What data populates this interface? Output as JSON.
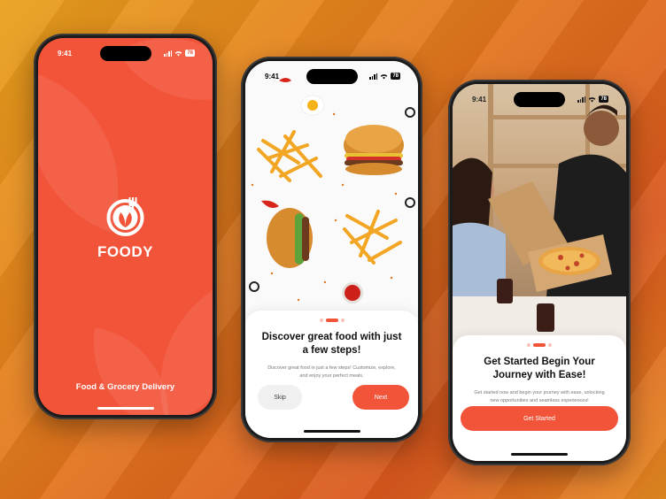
{
  "colors": {
    "brand": "#f2543a",
    "brand_light": "#f8c1b6",
    "background": "#e2751e"
  },
  "status": {
    "time": "9:41",
    "battery": "78"
  },
  "splash": {
    "app_name": "FOODY",
    "tagline": "Food & Grocery Delivery",
    "logo_icon": "fork-leaf-logo-icon"
  },
  "onboarding_1": {
    "title": "Discover great food with just a few steps!",
    "description": "Discover great food in just a few steps! Customize, explore, and enjoy your perfect meals.",
    "skip_label": "Skip",
    "next_label": "Next",
    "page_index": 1,
    "page_count": 3
  },
  "onboarding_2": {
    "title": "Get Started Begin Your Journey with Ease!",
    "description": "Get started now and begin your journey with ease, unlocking new opportunities and seamless experiences!",
    "cta_label": "Get Started",
    "page_index": 1,
    "page_count": 3
  }
}
